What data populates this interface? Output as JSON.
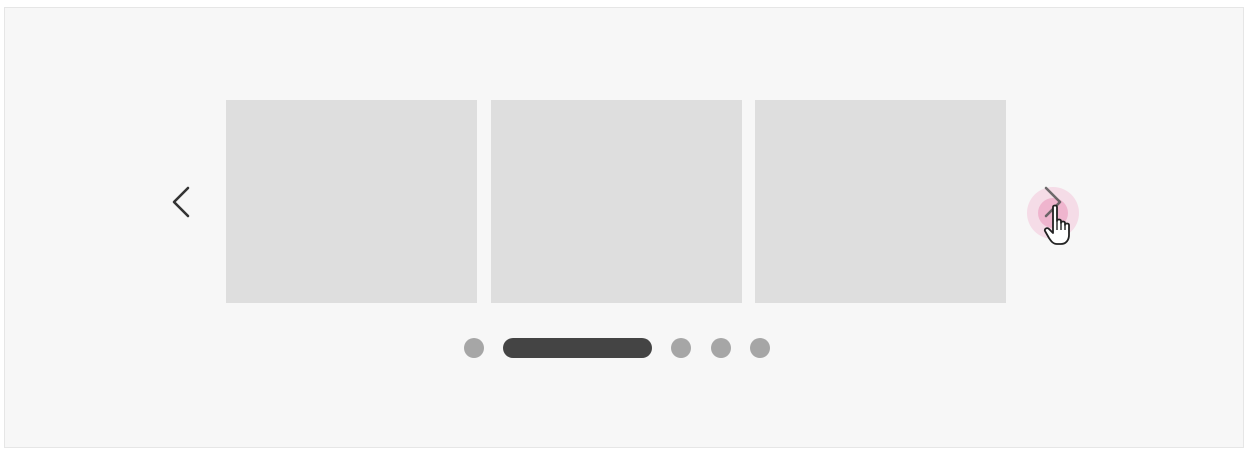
{
  "carousel": {
    "slides": [
      {
        "fill": "#dedede"
      },
      {
        "fill": "#dedede"
      },
      {
        "fill": "#dedede"
      }
    ],
    "prev_icon": "chevron-left-icon",
    "next_icon": "chevron-right-icon",
    "pagination": {
      "count": 5,
      "active_index": 1,
      "active_color": "#444444",
      "inactive_color": "#a6a6a6"
    },
    "cursor_icon": "hand-pointer-icon",
    "highlight_color": "#f096be"
  }
}
